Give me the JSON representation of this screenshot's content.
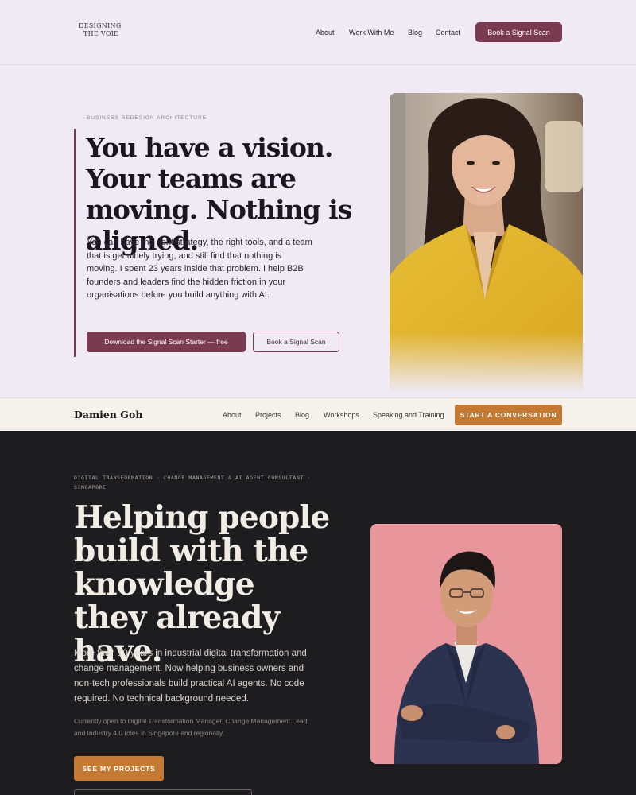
{
  "site1": {
    "logo": {
      "line1": "DESIGNING",
      "line2": "THE VOID"
    },
    "nav": {
      "about": "About",
      "work": "Work With Me",
      "blog": "Blog",
      "contact": "Contact",
      "cta": "Book a Signal Scan"
    },
    "hero": {
      "eyebrow": "BUSINESS REDESIGN ARCHITECTURE",
      "headline": "You have a vision. Your teams are moving. Nothing is aligned.",
      "body": "You can have the right strategy, the right tools, and a team that is genuinely trying, and still find that nothing is moving. I spent 23 years inside that problem. I help B2B founders and leaders find the hidden friction in your organisations before you build anything with AI.",
      "primary_btn": "Download the Signal Scan Starter — free",
      "secondary_btn": "Book a Signal Scan"
    },
    "colors": {
      "accent": "#7a3a4f",
      "background": "#efeaf4"
    }
  },
  "site2": {
    "brand": "Damien Goh",
    "nav": {
      "about": "About",
      "projects": "Projects",
      "blog": "Blog",
      "workshops": "Workshops",
      "speaking": "Speaking and Training",
      "cta": "START A CONVERSATION"
    },
    "hero": {
      "eyebrow": "DIGITAL TRANSFORMATION · CHANGE MANAGEMENT & AI AGENT CONSULTANT · SINGAPORE",
      "headline": "Helping people build with the knowledge they already have.",
      "body": "More than 10 years in industrial digital transformation and change management. Now helping business owners and non-tech professionals build practical AI agents. No code required. No technical background needed.",
      "note": "Currently open to Digital Transformation Manager, Change Management Lead, and Industry 4.0 roles in Singapore and regionally.",
      "primary_btn": "SEE MY PROJECTS"
    },
    "colors": {
      "accent": "#c47a33",
      "background": "#1d1d20"
    }
  }
}
